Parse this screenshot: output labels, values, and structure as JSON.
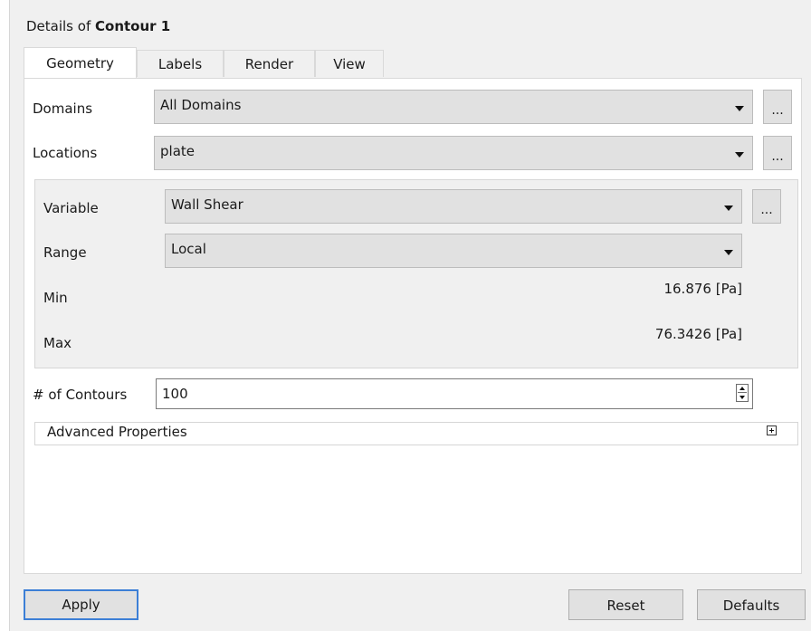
{
  "panel": {
    "title_prefix": "Details of ",
    "title_object": "Contour 1"
  },
  "tabs": [
    {
      "label": "Geometry",
      "active": true
    },
    {
      "label": "Labels",
      "active": false
    },
    {
      "label": "Render",
      "active": false
    },
    {
      "label": "View",
      "active": false
    }
  ],
  "geometry": {
    "domains": {
      "label": "Domains",
      "value": "All Domains",
      "more": "..."
    },
    "locations": {
      "label": "Locations",
      "value": "plate",
      "more": "..."
    },
    "variable": {
      "label": "Variable",
      "value": "Wall Shear",
      "more": "..."
    },
    "range": {
      "label": "Range",
      "value": "Local"
    },
    "min": {
      "label": "Min",
      "value": "16.876 [Pa]"
    },
    "max": {
      "label": "Max",
      "value": "76.3426 [Pa]"
    },
    "contours": {
      "label": "# of Contours",
      "value": "100"
    },
    "advanced": {
      "label": "Advanced Properties",
      "icon": "expand-plus-icon"
    }
  },
  "buttons": {
    "apply": "Apply",
    "reset": "Reset",
    "defaults": "Defaults"
  },
  "icons": {
    "dropdown": "chevron-down-icon",
    "spinner": "spinner-icon"
  },
  "colors": {
    "default_button_border": "#3c7fd6",
    "combo_bg": "#e1e1e1",
    "panel_bg": "#ffffff"
  }
}
